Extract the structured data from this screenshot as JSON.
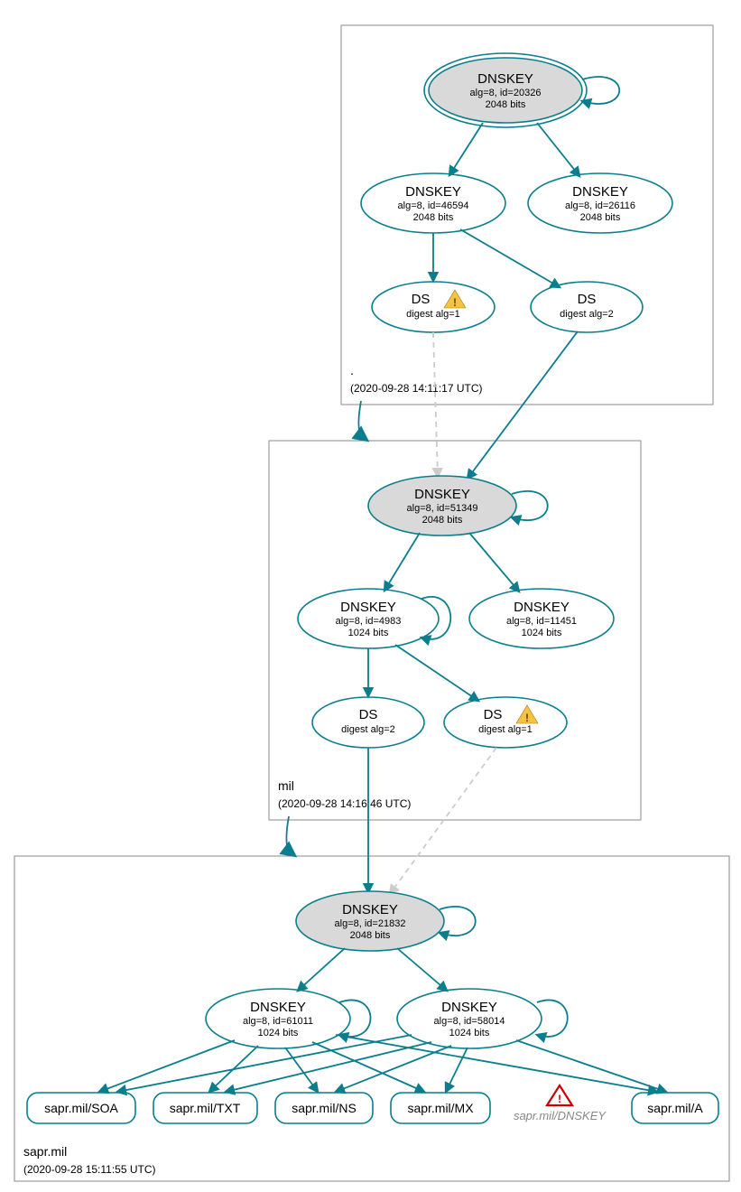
{
  "colors": {
    "accent": "#0a7e8c",
    "node_grey": "#d9d9d9",
    "dashed": "#cccccc",
    "error": "#cc0000",
    "warn": "#f6c244"
  },
  "zones": {
    "root": {
      "name": ".",
      "timestamp": "(2020-09-28 14:11:17 UTC)"
    },
    "mil": {
      "name": "mil",
      "timestamp": "(2020-09-28 14:16:46 UTC)"
    },
    "sapr": {
      "name": "sapr.mil",
      "timestamp": "(2020-09-28 15:11:55 UTC)"
    }
  },
  "nodes": {
    "root_ksk": {
      "title": "DNSKEY",
      "line2": "alg=8, id=20326",
      "line3": "2048 bits"
    },
    "root_k2": {
      "title": "DNSKEY",
      "line2": "alg=8, id=46594",
      "line3": "2048 bits"
    },
    "root_k3": {
      "title": "DNSKEY",
      "line2": "alg=8, id=26116",
      "line3": "2048 bits"
    },
    "root_ds1": {
      "title": "DS",
      "line2": "digest alg=1",
      "warn": true
    },
    "root_ds2": {
      "title": "DS",
      "line2": "digest alg=2"
    },
    "mil_ksk": {
      "title": "DNSKEY",
      "line2": "alg=8, id=51349",
      "line3": "2048 bits"
    },
    "mil_k2": {
      "title": "DNSKEY",
      "line2": "alg=8, id=4983",
      "line3": "1024 bits"
    },
    "mil_k3": {
      "title": "DNSKEY",
      "line2": "alg=8, id=11451",
      "line3": "1024 bits"
    },
    "mil_ds2": {
      "title": "DS",
      "line2": "digest alg=2"
    },
    "mil_ds1": {
      "title": "DS",
      "line2": "digest alg=1",
      "warn": true
    },
    "sapr_ksk": {
      "title": "DNSKEY",
      "line2": "alg=8, id=21832",
      "line3": "2048 bits"
    },
    "sapr_k2": {
      "title": "DNSKEY",
      "line2": "alg=8, id=61011",
      "line3": "1024 bits"
    },
    "sapr_k3": {
      "title": "DNSKEY",
      "line2": "alg=8, id=58014",
      "line3": "1024 bits"
    }
  },
  "rr": {
    "soa": "sapr.mil/SOA",
    "txt": "sapr.mil/TXT",
    "ns": "sapr.mil/NS",
    "mx": "sapr.mil/MX",
    "dnskey_err": "sapr.mil/DNSKEY",
    "a": "sapr.mil/A"
  }
}
